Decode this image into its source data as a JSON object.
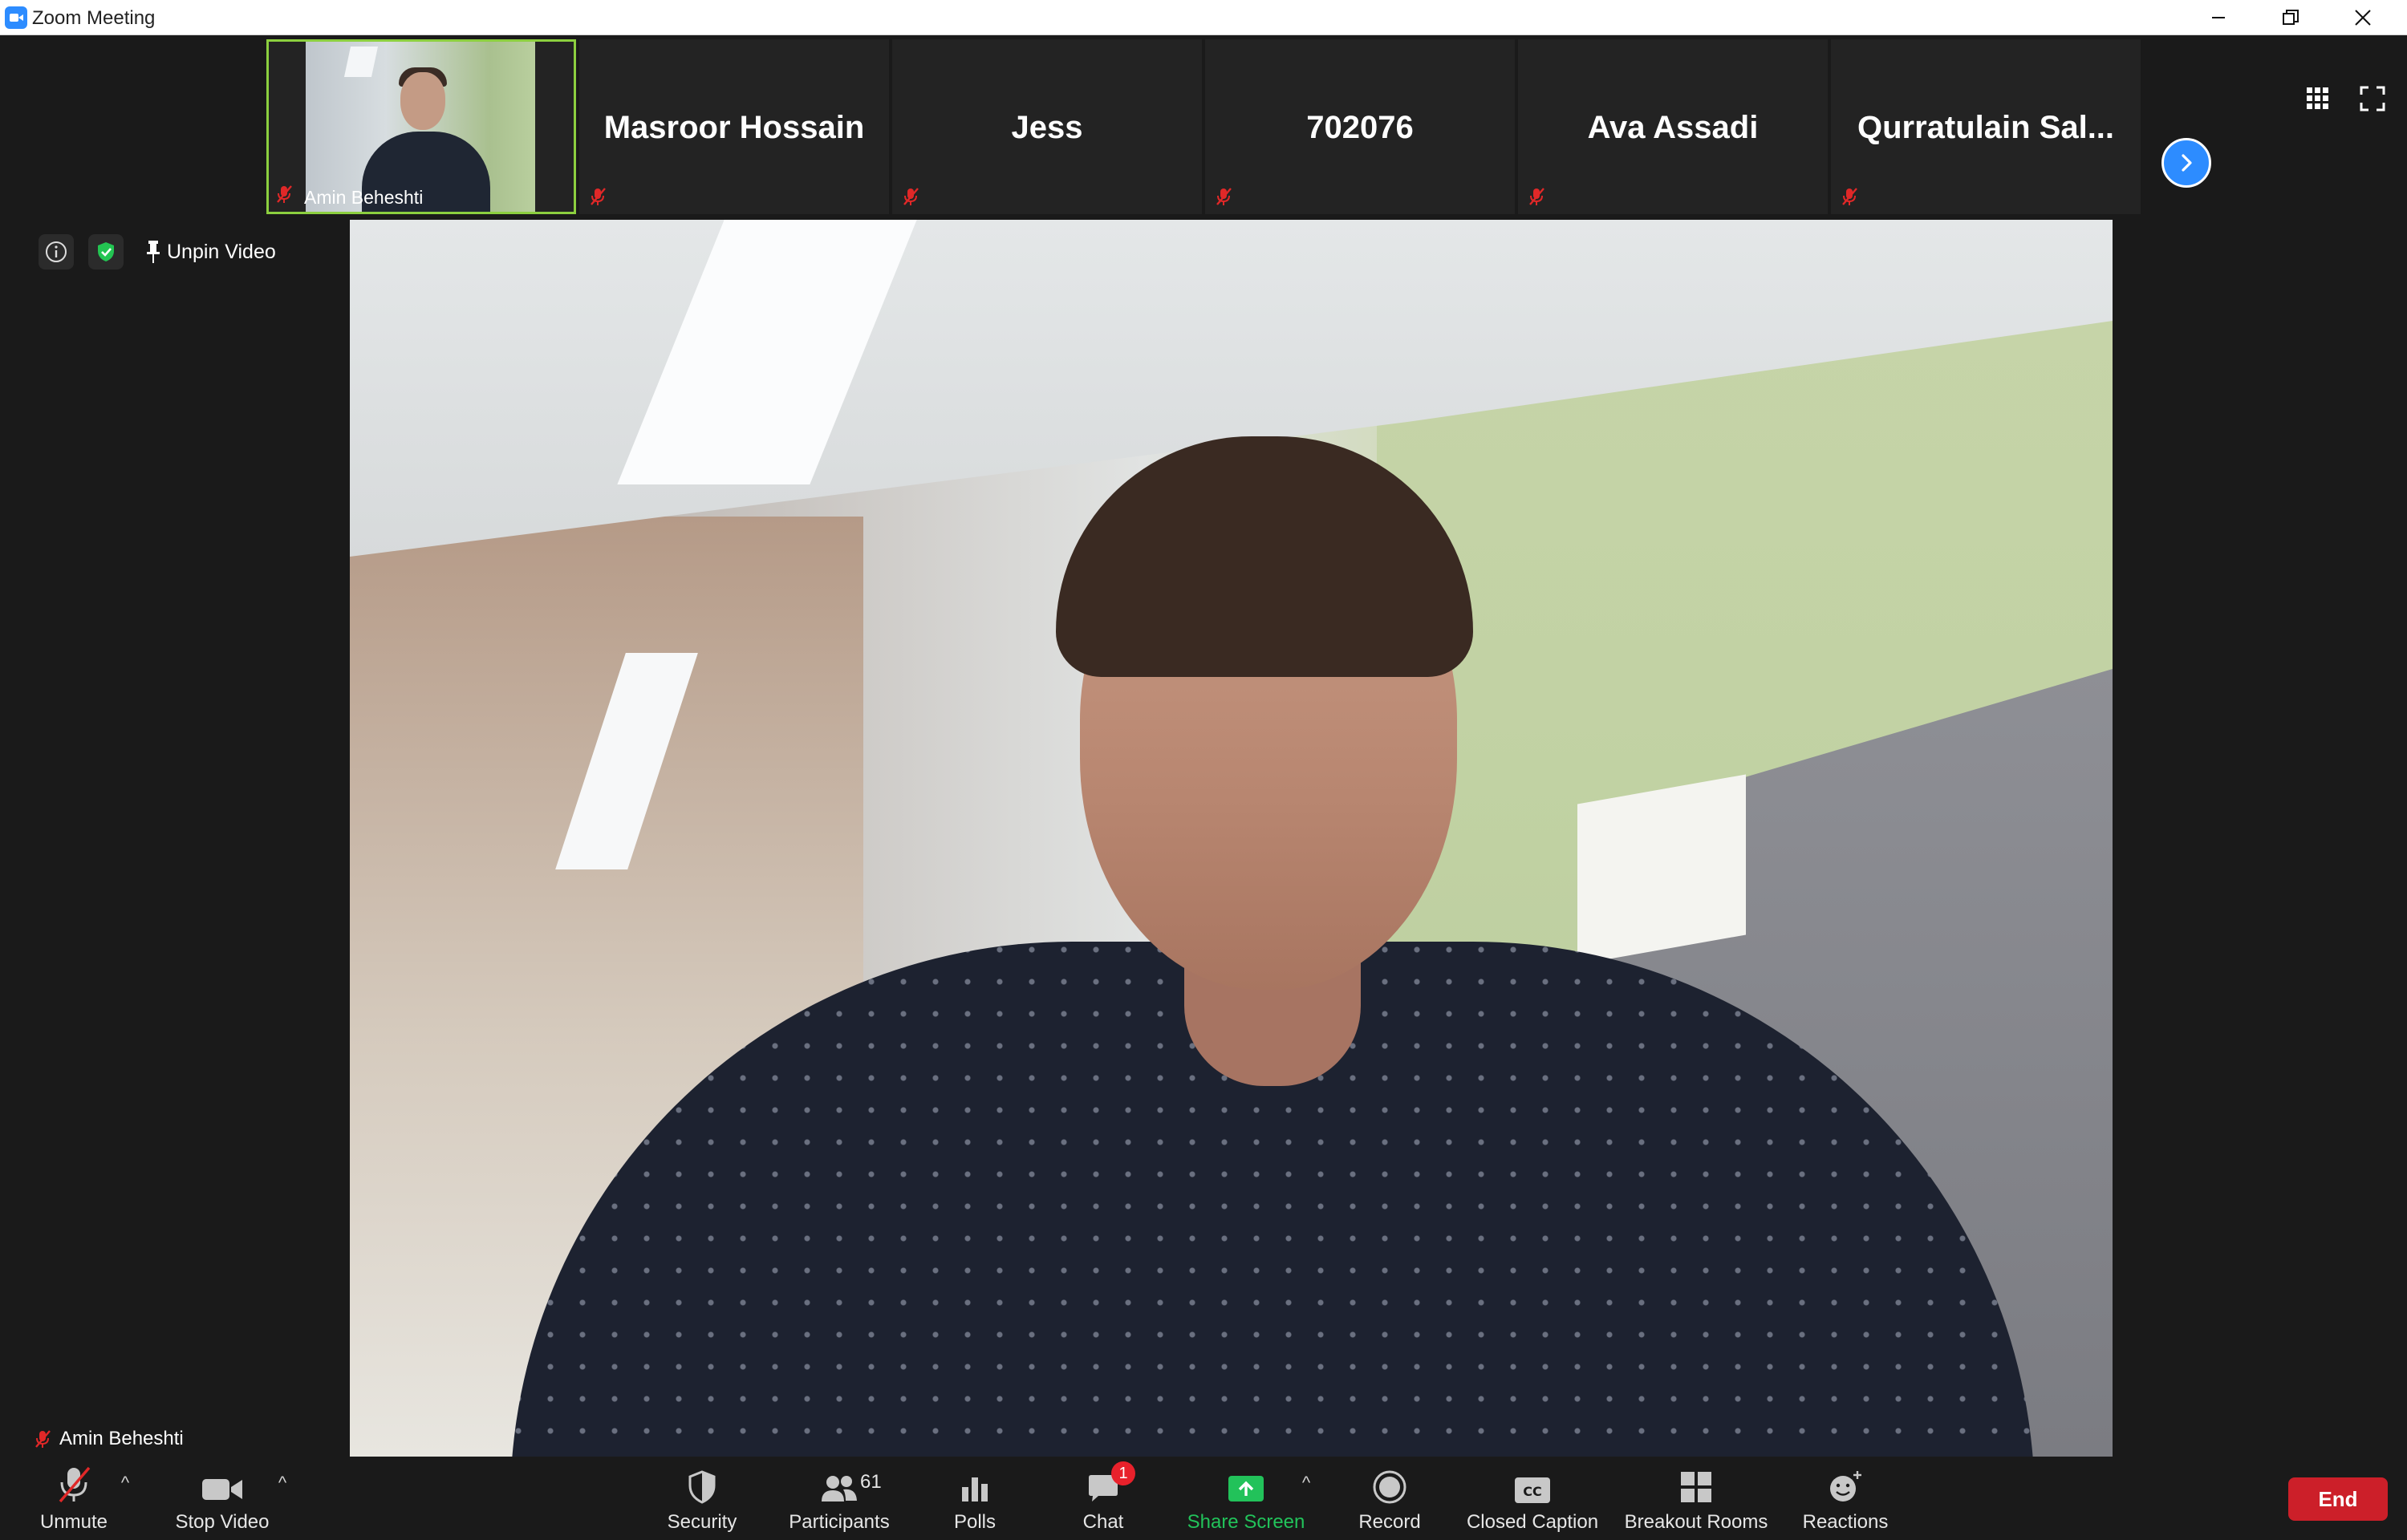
{
  "window": {
    "title": "Zoom Meeting"
  },
  "strip": {
    "self": {
      "name": "Amin Beheshti"
    },
    "participants": [
      {
        "name": "Masroor Hossain"
      },
      {
        "name": "Jess"
      },
      {
        "name": "702076"
      },
      {
        "name": "Ava Assadi"
      },
      {
        "name": "Qurratulain  Sal..."
      }
    ]
  },
  "main": {
    "unpin_label": "Unpin Video",
    "speaker_name": "Amin Beheshti"
  },
  "toolbar": {
    "unmute": "Unmute",
    "stop_video": "Stop Video",
    "security": "Security",
    "participants": "Participants",
    "participants_count": "61",
    "polls": "Polls",
    "chat": "Chat",
    "chat_badge": "1",
    "share_screen": "Share Screen",
    "record": "Record",
    "closed_caption": "Closed Caption",
    "breakout_rooms": "Breakout Rooms",
    "reactions": "Reactions",
    "end": "End"
  },
  "colors": {
    "accent_blue": "#2d8cff",
    "active_border": "#8ccf3f",
    "share_green": "#22c25a",
    "end_red": "#cc1f29",
    "muted_red": "#e02828",
    "secure_green": "#23c552"
  }
}
